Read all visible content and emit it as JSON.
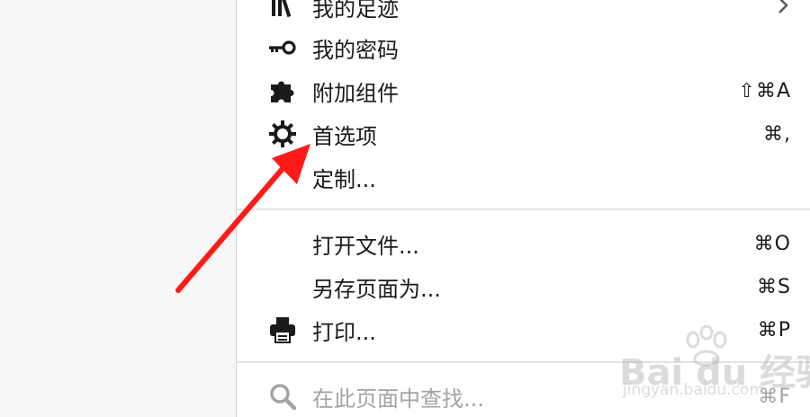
{
  "menu": {
    "items": [
      {
        "label": "我的足迹",
        "shortcut": "",
        "icon": "library-icon",
        "submenu": true
      },
      {
        "label": "我的密码",
        "shortcut": "",
        "icon": "key-icon"
      },
      {
        "label": "附加组件",
        "shortcut": "⇧⌘A",
        "icon": "puzzle-icon"
      },
      {
        "label": "首选项",
        "shortcut": "⌘,",
        "icon": "gear-icon"
      },
      {
        "label": "定制...",
        "shortcut": "",
        "icon": ""
      },
      {
        "label": "打开文件...",
        "shortcut": "⌘O",
        "icon": ""
      },
      {
        "label": "另存页面为...",
        "shortcut": "⌘S",
        "icon": ""
      },
      {
        "label": "打印...",
        "shortcut": "⌘P",
        "icon": "printer-icon"
      },
      {
        "label": "在此页面中查找...",
        "shortcut": "⌘F",
        "icon": "search-icon",
        "disabled": true
      }
    ]
  },
  "annotation": {
    "arrow_color": "#ff1a1a"
  },
  "watermark": {
    "brand": "Bai du 经验",
    "url": "jingyan.baidu.com"
  }
}
